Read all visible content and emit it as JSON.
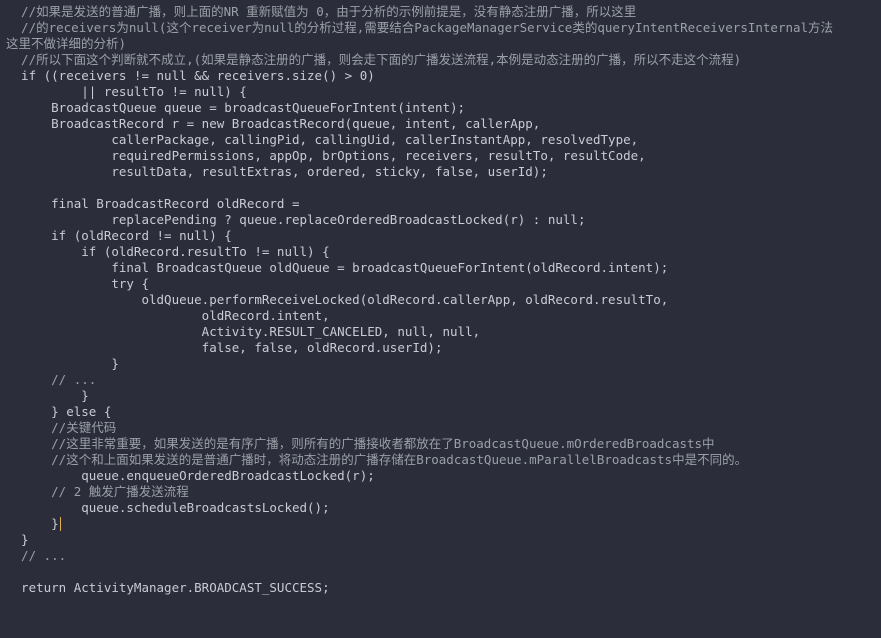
{
  "code": {
    "lines": [
      {
        "cls": "comment",
        "text": "  //如果是发送的普通广播，则上面的NR 重新赋值为 0，由于分析的示例前提是，没有静态注册广播，所以这里"
      },
      {
        "cls": "comment",
        "text": "  //的receivers为null(这个receiver为null的分析过程,需要结合PackageManagerService类的queryIntentReceiversInternal方法"
      },
      {
        "cls": "comment",
        "text": "这里不做详细的分析)"
      },
      {
        "cls": "comment",
        "text": "  //所以下面这个判断就不成立,(如果是静态注册的广播，则会走下面的广播发送流程,本例是动态注册的广播，所以不走这个流程)"
      },
      {
        "cls": "text",
        "text": "  if ((receivers != null && receivers.size() > 0)"
      },
      {
        "cls": "text",
        "text": "          || resultTo != null) {"
      },
      {
        "cls": "text",
        "text": "      BroadcastQueue queue = broadcastQueueForIntent(intent);"
      },
      {
        "cls": "text",
        "text": "      BroadcastRecord r = new BroadcastRecord(queue, intent, callerApp,"
      },
      {
        "cls": "text",
        "text": "              callerPackage, callingPid, callingUid, callerInstantApp, resolvedType,"
      },
      {
        "cls": "text",
        "text": "              requiredPermissions, appOp, brOptions, receivers, resultTo, resultCode,"
      },
      {
        "cls": "text",
        "text": "              resultData, resultExtras, ordered, sticky, false, userId);"
      },
      {
        "cls": "text",
        "text": ""
      },
      {
        "cls": "text",
        "text": "      final BroadcastRecord oldRecord ="
      },
      {
        "cls": "text",
        "text": "              replacePending ? queue.replaceOrderedBroadcastLocked(r) : null;"
      },
      {
        "cls": "text",
        "text": "      if (oldRecord != null) {"
      },
      {
        "cls": "text",
        "text": "          if (oldRecord.resultTo != null) {"
      },
      {
        "cls": "text",
        "text": "              final BroadcastQueue oldQueue = broadcastQueueForIntent(oldRecord.intent);"
      },
      {
        "cls": "text",
        "text": "              try {"
      },
      {
        "cls": "text",
        "text": "                  oldQueue.performReceiveLocked(oldRecord.callerApp, oldRecord.resultTo,"
      },
      {
        "cls": "text",
        "text": "                          oldRecord.intent,"
      },
      {
        "cls": "text",
        "text": "                          Activity.RESULT_CANCELED, null, null,"
      },
      {
        "cls": "text",
        "text": "                          false, false, oldRecord.userId);"
      },
      {
        "cls": "text",
        "text": "              }"
      },
      {
        "cls": "comment",
        "text": "      // ..."
      },
      {
        "cls": "text",
        "text": "          }"
      },
      {
        "cls": "text",
        "text": "      } else {"
      },
      {
        "cls": "comment",
        "text": "      //关键代码"
      },
      {
        "cls": "comment",
        "text": "      //这里非常重要，如果发送的是有序广播，则所有的广播接收者都放在了BroadcastQueue.mOrderedBroadcasts中"
      },
      {
        "cls": "comment",
        "text": "      //这个和上面如果发送的是普通广播时，将动态注册的广播存储在BroadcastQueue.mParallelBroadcasts中是不同的。"
      },
      {
        "cls": "text",
        "text": "          queue.enqueueOrderedBroadcastLocked(r);"
      },
      {
        "cls": "comment",
        "text": "      // 2 触发广播发送流程"
      },
      {
        "cls": "text",
        "text": "          queue.scheduleBroadcastsLocked();"
      },
      {
        "cls": "text",
        "text": "      }",
        "cursor": true
      },
      {
        "cls": "text",
        "text": "  }"
      },
      {
        "cls": "comment",
        "text": "  // ..."
      },
      {
        "cls": "text",
        "text": ""
      },
      {
        "cls": "text",
        "text": "  return ActivityManager.BROADCAST_SUCCESS;"
      }
    ]
  }
}
